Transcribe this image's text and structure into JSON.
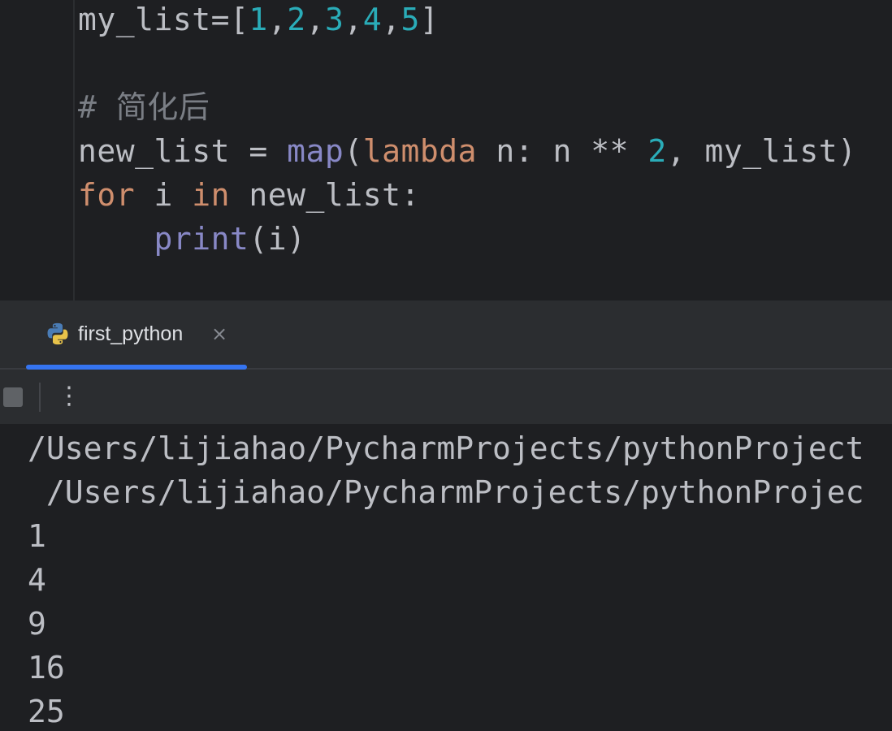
{
  "editor": {
    "line1": {
      "a": "my_list=[",
      "n1": "1",
      "c1": ",",
      "n2": "2",
      "c2": ",",
      "n3": "3",
      "c3": ",",
      "n4": "4",
      "c4": ",",
      "n5": "5",
      "end": "]"
    },
    "comment": {
      "hash": "# ",
      "text": "简化后"
    },
    "line3": {
      "a": "new_list = ",
      "map": "map",
      "paren": "(",
      "lambda": "lambda",
      "b": " n: n ** ",
      "num": "2",
      "c": ", my_list)"
    },
    "line4": {
      "for": "for",
      "a": " i ",
      "in": "in",
      "b": " new_list:"
    },
    "line5": {
      "indent": "    ",
      "print": "print",
      "b": "(i)"
    }
  },
  "run": {
    "tab_label": "first_python",
    "close_glyph": "×",
    "more_glyph": "⋮",
    "icon": "python-icon"
  },
  "console": {
    "lines": [
      "/Users/lijiahao/PycharmProjects/pythonProject",
      " /Users/lijiahao/PycharmProjects/pythonProjec",
      "1",
      "4",
      "9",
      "16",
      "25"
    ]
  },
  "colors": {
    "background": "#1e1f22",
    "number": "#2aacb8",
    "keyword": "#cf8e6d",
    "builtin": "#8888c6",
    "comment": "#7a7e85",
    "tab_accent": "#3574f0"
  }
}
